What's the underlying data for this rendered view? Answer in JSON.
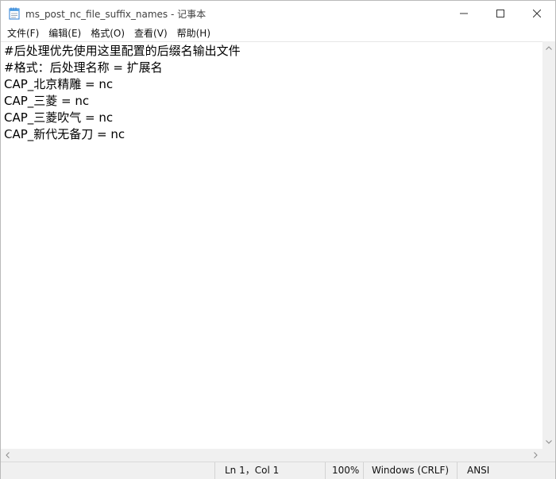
{
  "window": {
    "title": "ms_post_nc_file_suffix_names - 记事本",
    "app_icon": "notepad-icon"
  },
  "menu": {
    "items": [
      {
        "label": "文件(F)"
      },
      {
        "label": "编辑(E)"
      },
      {
        "label": "格式(O)"
      },
      {
        "label": "查看(V)"
      },
      {
        "label": "帮助(H)"
      }
    ]
  },
  "editor": {
    "lines": [
      "#后处理优先使用这里配置的后缀名输出文件",
      "#格式：后处理名称 = 扩展名",
      "CAP_北京精雕 = nc",
      "CAP_三菱 = nc",
      "CAP_三菱吹气 = nc",
      "CAP_新代无备刀 = nc"
    ]
  },
  "status": {
    "position": "Ln 1，Col 1",
    "zoom": "100%",
    "line_ending": "Windows (CRLF)",
    "encoding": "ANSI"
  },
  "colors": {
    "chrome_bg": "#f0f0f0",
    "text": "#000000"
  }
}
